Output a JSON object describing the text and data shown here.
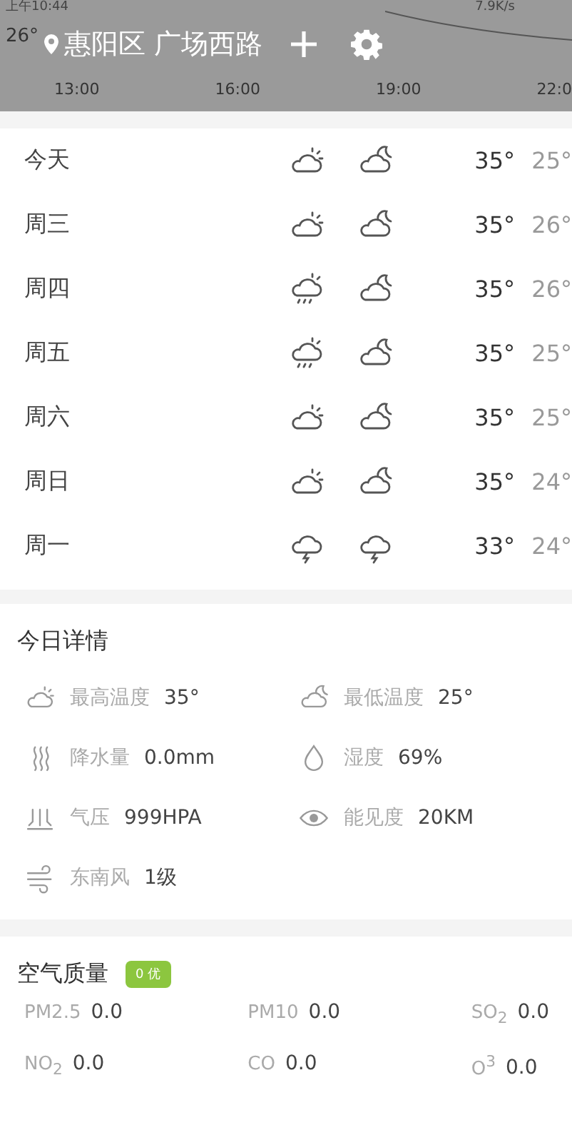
{
  "status_bar": {
    "time": "上午10:44",
    "speed": "7.9K/s"
  },
  "header": {
    "current_temp": "26°",
    "location": "惠阳区 广场西路"
  },
  "hourly_axis": [
    "13:00",
    "16:00",
    "19:00",
    "22:0"
  ],
  "forecast": [
    {
      "day": "今天",
      "icons": [
        {
          "kind": "sun-cloud"
        },
        {
          "kind": "moon-cloud"
        }
      ],
      "high": "35°",
      "low": "25°"
    },
    {
      "day": "周三",
      "icons": [
        {
          "kind": "sun-cloud"
        },
        {
          "kind": "moon-cloud"
        }
      ],
      "high": "35°",
      "low": "26°"
    },
    {
      "day": "周四",
      "icons": [
        {
          "kind": "sun-rain"
        },
        {
          "kind": "moon-cloud"
        }
      ],
      "high": "35°",
      "low": "26°"
    },
    {
      "day": "周五",
      "icons": [
        {
          "kind": "sun-rain"
        },
        {
          "kind": "moon-cloud"
        }
      ],
      "high": "35°",
      "low": "25°"
    },
    {
      "day": "周六",
      "icons": [
        {
          "kind": "sun-cloud"
        },
        {
          "kind": "moon-cloud"
        }
      ],
      "high": "35°",
      "low": "25°"
    },
    {
      "day": "周日",
      "icons": [
        {
          "kind": "sun-cloud"
        },
        {
          "kind": "moon-cloud"
        }
      ],
      "high": "35°",
      "low": "24°"
    },
    {
      "day": "周一",
      "icons": [
        {
          "kind": "thunder"
        },
        {
          "kind": "thunder"
        }
      ],
      "high": "33°",
      "low": "24°"
    }
  ],
  "details": {
    "title": "今日详情",
    "items": [
      {
        "kind": "sun-cloud",
        "label": "最高温度",
        "value": "35°"
      },
      {
        "kind": "moon-cloud",
        "label": "最低温度",
        "value": "25°"
      },
      {
        "kind": "rain",
        "label": "降水量",
        "value": "0.0mm"
      },
      {
        "kind": "drop",
        "label": "湿度",
        "value": "69%"
      },
      {
        "kind": "pressure",
        "label": "气压",
        "value": "999HPA"
      },
      {
        "kind": "eye",
        "label": "能见度",
        "value": "20KM"
      },
      {
        "kind": "wind",
        "label": "东南风",
        "value": "1级"
      }
    ]
  },
  "air_quality": {
    "title": "空气质量",
    "badge": "0 优",
    "items": [
      {
        "label": "PM2.5",
        "value": "0.0"
      },
      {
        "label": "PM10",
        "value": "0.0"
      },
      {
        "label": "SO$_{2}$",
        "value": "0.0"
      },
      {
        "label": "NO$_{2}$",
        "value": "0.0"
      },
      {
        "label": "CO",
        "value": "0.0"
      },
      {
        "label": "O$^{3}$",
        "value": "0.0"
      }
    ]
  }
}
